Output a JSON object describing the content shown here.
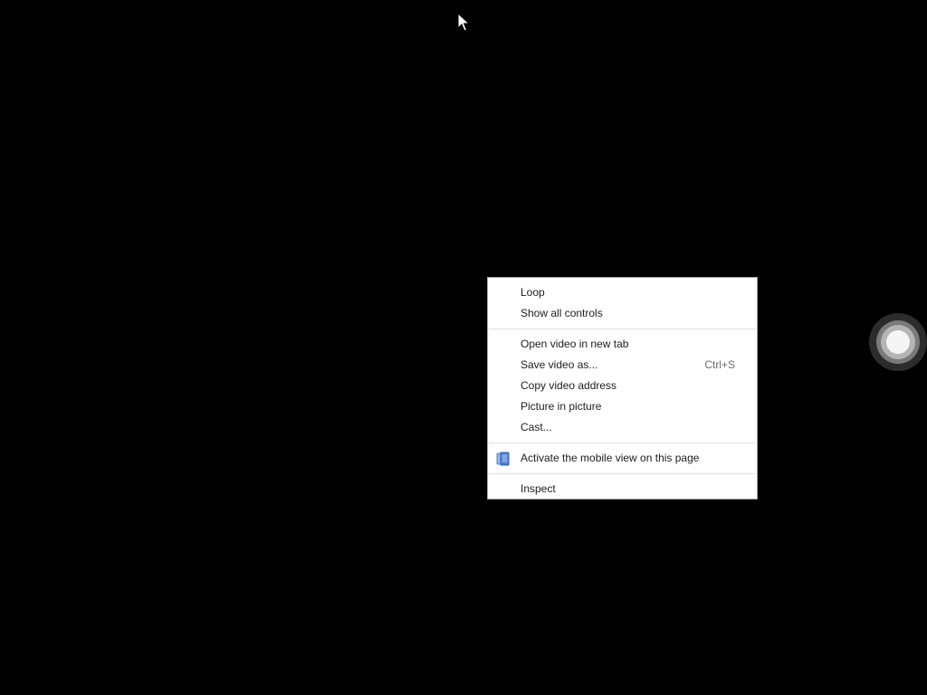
{
  "context_menu": {
    "group1": [
      {
        "label": "Loop",
        "shortcut": ""
      },
      {
        "label": "Show all controls",
        "shortcut": ""
      }
    ],
    "group2": [
      {
        "label": "Open video in new tab",
        "shortcut": ""
      },
      {
        "label": "Save video as...",
        "shortcut": "Ctrl+S"
      },
      {
        "label": "Copy video address",
        "shortcut": ""
      },
      {
        "label": "Picture in picture",
        "shortcut": ""
      },
      {
        "label": "Cast...",
        "shortcut": ""
      }
    ],
    "group3": [
      {
        "label": "Activate the mobile view on this page",
        "icon": "mobile-view-extension-icon"
      }
    ],
    "group4": [
      {
        "label": "Inspect",
        "shortcut": ""
      }
    ]
  },
  "colors": {
    "background": "#000000",
    "menu_background": "#ffffff",
    "menu_text": "#202020",
    "shortcut_text": "#6b6b6b",
    "icon_blue": "#4a7fd4"
  },
  "icons": {
    "cursor": "mouse-pointer-icon",
    "touch": "touch-indicator-icon"
  }
}
